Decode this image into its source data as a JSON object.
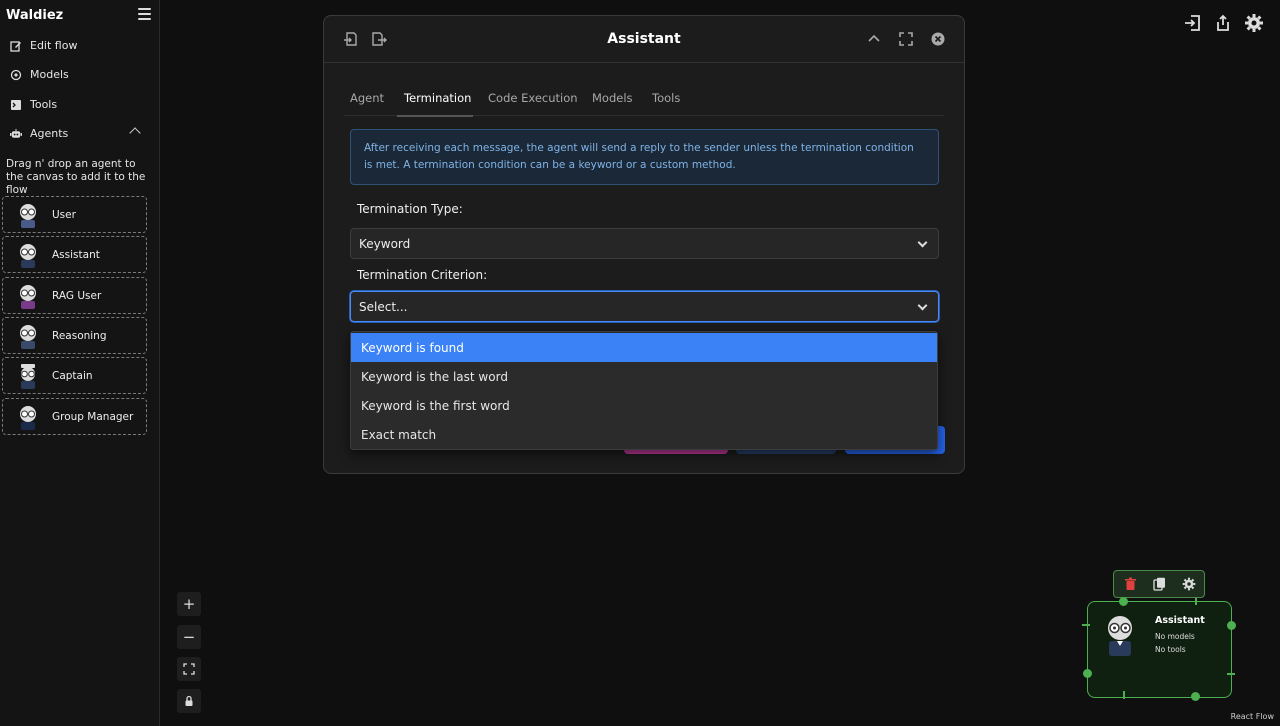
{
  "sidebar": {
    "brand": "Waldiez",
    "menu": [
      {
        "label": "Edit flow",
        "icon": "edit-icon"
      },
      {
        "label": "Models",
        "icon": "models-icon"
      },
      {
        "label": "Tools",
        "icon": "tools-icon"
      },
      {
        "label": "Agents",
        "icon": "robot-icon"
      }
    ],
    "drag_hint": "Drag n' drop an agent to the canvas to add it to the flow",
    "agents": [
      "User",
      "Assistant",
      "RAG User",
      "Reasoning",
      "Captain",
      "Group Manager"
    ]
  },
  "modal": {
    "title": "Assistant",
    "tabs": [
      "Agent",
      "Termination",
      "Code Execution",
      "Models",
      "Tools"
    ],
    "active_tab": "Termination",
    "info": "After receiving each message, the agent will send a reply to the sender unless the termination condition is met. A termination condition can be a keyword or a custom method.",
    "termination_type_label": "Termination Type:",
    "termination_type_value": "Keyword",
    "termination_criterion_label": "Termination Criterion:",
    "termination_criterion_placeholder": "Select...",
    "criterion_options": [
      "Keyword is found",
      "Keyword is the last word",
      "Keyword is the first word",
      "Exact match"
    ],
    "highlighted_option": "Keyword is found"
  },
  "node": {
    "title": "Assistant",
    "models": "No models",
    "tools": "No tools"
  },
  "canvas": {
    "attribution": "React Flow"
  },
  "colors": {
    "accent": "#3b82f6",
    "node_border": "#4caf50",
    "info_text": "#7fb3e6"
  }
}
